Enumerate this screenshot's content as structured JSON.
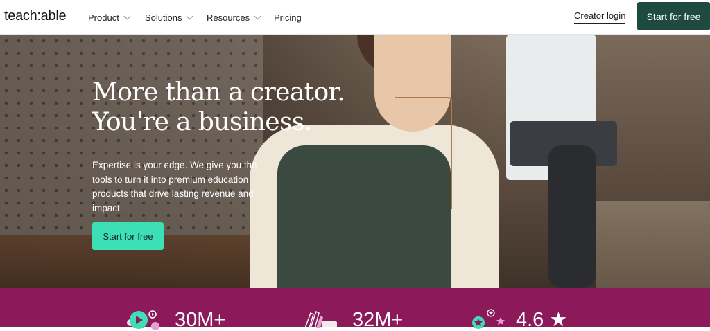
{
  "header": {
    "logo": "teach:able",
    "nav": [
      {
        "label": "Product"
      },
      {
        "label": "Solutions"
      },
      {
        "label": "Resources"
      },
      {
        "label": "Pricing"
      }
    ],
    "login_label": "Creator login",
    "cta_label": "Start for free"
  },
  "hero": {
    "title_line1": "More than a creator.",
    "title_line2": "You're a business.",
    "subtitle": "Expertise is your edge. We give you the tools to turn it into premium education products that drive lasting revenue and impact.",
    "cta_label": "Start for free"
  },
  "stats": [
    {
      "value": "30M+",
      "icon": "video-play-icon"
    },
    {
      "value": "32M+",
      "icon": "clapping-hands-icon"
    },
    {
      "value": "4.6 ★",
      "icon": "star-rating-icon"
    }
  ],
  "colors": {
    "brand_dark": "#1f4a40",
    "accent": "#3de0b6",
    "stats_band": "#8c1a5a"
  }
}
